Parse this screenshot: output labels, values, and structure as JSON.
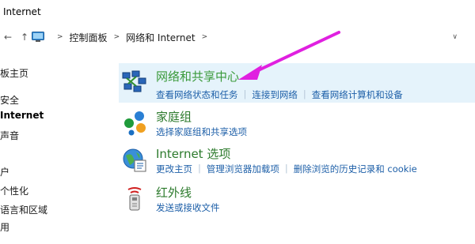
{
  "window": {
    "title": "Internet"
  },
  "nav": {
    "back_icon": "back-arrow-icon",
    "forward_icon": "forward-arrow-icon",
    "up_icon": "up-arrow-icon"
  },
  "address_bar": {
    "icon": "control-panel-icon",
    "crumbs": [
      "控制面板",
      "网络和 Internet"
    ]
  },
  "left_nav": {
    "items": [
      {
        "label": "板主页"
      },
      {
        "label": "安全"
      },
      {
        "label": "Internet"
      },
      {
        "label": "声音"
      },
      {
        "label": "户"
      },
      {
        "label": "个性化"
      },
      {
        "label": "语言和区域"
      },
      {
        "label": "用"
      }
    ]
  },
  "categories": [
    {
      "title": "网络和共享中心",
      "icon": "network-sharing-icon",
      "links": [
        "查看网络状态和任务",
        "连接到网络",
        "查看网络计算机和设备"
      ]
    },
    {
      "title": "家庭组",
      "icon": "homegroup-icon",
      "links": [
        "选择家庭组和共享选项"
      ]
    },
    {
      "title": "Internet 选项",
      "icon": "internet-options-icon",
      "links": [
        "更改主页",
        "管理浏览器加载项",
        "删除浏览的历史记录和 cookie"
      ]
    },
    {
      "title": "红外线",
      "icon": "infrared-icon",
      "links": [
        "发送或接收文件"
      ]
    }
  ],
  "colors": {
    "highlight": "#e5f3fb",
    "category_title": "#2c7a2c",
    "link": "#1d5fa8",
    "annotation_arrow": "#e020e0"
  }
}
